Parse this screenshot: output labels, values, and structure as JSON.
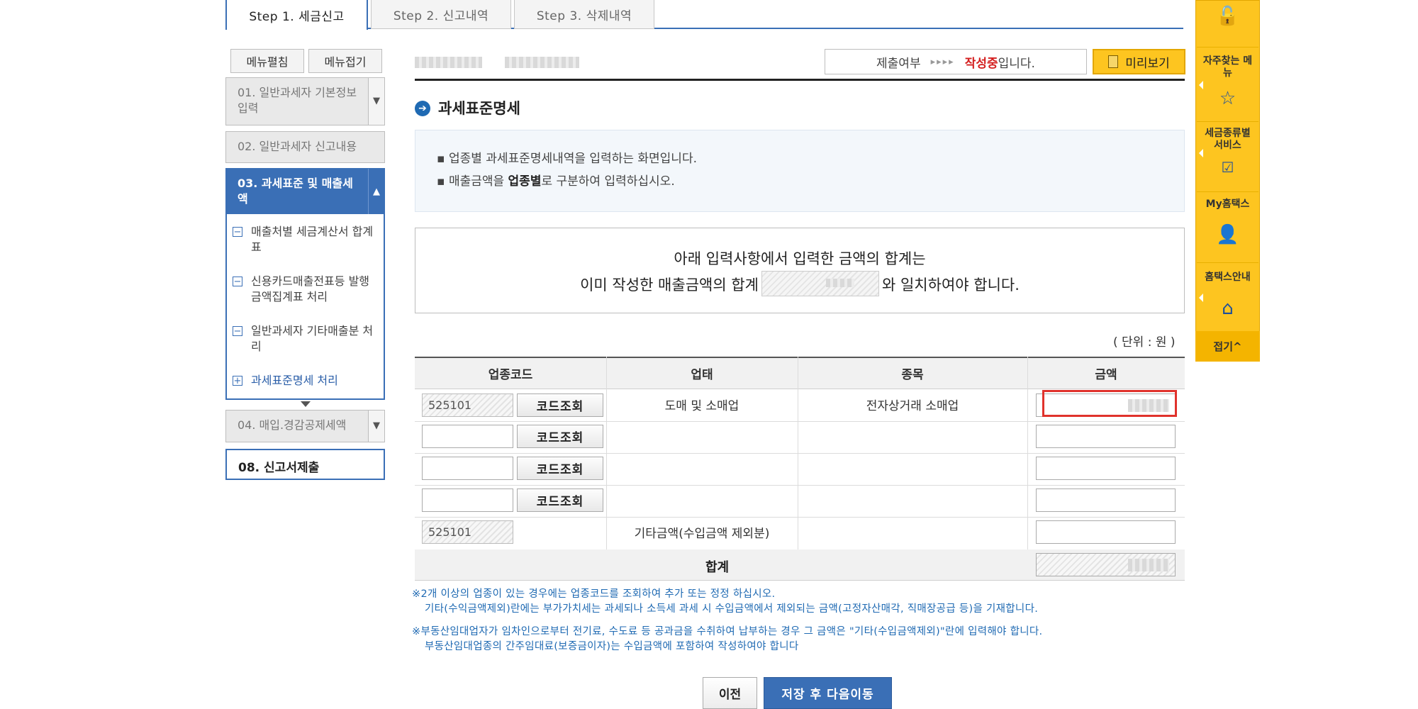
{
  "tabs": [
    "Step 1. 세금신고",
    "Step 2. 신고내역",
    "Step 3. 삭제내역"
  ],
  "menu_buttons": {
    "expand": "메뉴펼침",
    "collapse": "메뉴접기"
  },
  "nav": {
    "item1": "01. 일반과세자 기본정보입력",
    "item2": "02. 일반과세자 신고내용",
    "item3": "03. 과세표준 및 매출세액",
    "sub": [
      "매출처별 세금계산서 합계표",
      "신용카드매출전표등 발행금액집계표 처리",
      "일반과세자 기타매출분 처리",
      "과세표준명세 처리"
    ],
    "item4": "04. 매입.경감공제세액",
    "item8": "08. 신고서제출"
  },
  "status": {
    "label": "제출여부",
    "arrows": "▸▸▸▸",
    "state": "작성중",
    "suffix": "입니다."
  },
  "preview_label": "미리보기",
  "section_title": "과세표준명세",
  "info": {
    "line1": "업종별 과세표준명세내역을 입력하는 화면입니다.",
    "line2_pre": "매출금액을 ",
    "line2_bold": "업종별",
    "line2_post": "로 구분하여 입력하십시오."
  },
  "notice": {
    "line1": "아래 입력사항에서  입력한 금액의 합계는",
    "line2_pre": "이미 작성한 매출금액의 합계",
    "line2_post": "와 일치하여야 합니다."
  },
  "unit": "( 단위 : 원 )",
  "table": {
    "headers": [
      "업종코드",
      "업태",
      "종목",
      "금액"
    ],
    "code_button": "코드조회",
    "row1": {
      "code": "525101",
      "type": "도매 및 소매업",
      "item": "전자상거래 소매업"
    },
    "row5": {
      "code": "525101",
      "label": "기타금액(수입금액 제외분)"
    },
    "total_label": "합계"
  },
  "notes": {
    "n1a": "※2개 이상의 업종이 있는 경우에는 업종코드를 조회하여 추가 또는 정정 하십시오.",
    "n1b": "기타(수익금액제외)란에는 부가가치세는 과세되나 소득세 과세 시 수입금액에서 제외되는 금액(고정자산매각, 직매장공급 등)을 기재합니다.",
    "n2a": "※부동산임대업자가 임차인으로부터 전기료, 수도료 등 공과금을 수취하여 납부하는 경우 그 금액은 \"기타(수입금액제외)\"란에 입력해야 합니다.",
    "n2b": "부동산임대업종의 간주임대료(보증금이자)는 수입금액에 포함하여 작성하여야 합니다"
  },
  "buttons": {
    "prev": "이전",
    "next": "저장 후 다음이동"
  },
  "quickbar": {
    "faq": "자주찾는 메뉴",
    "tax": "세금종류별 서비스",
    "my": "My홈택스",
    "guide": "홈택스안내",
    "fold": "접기"
  }
}
